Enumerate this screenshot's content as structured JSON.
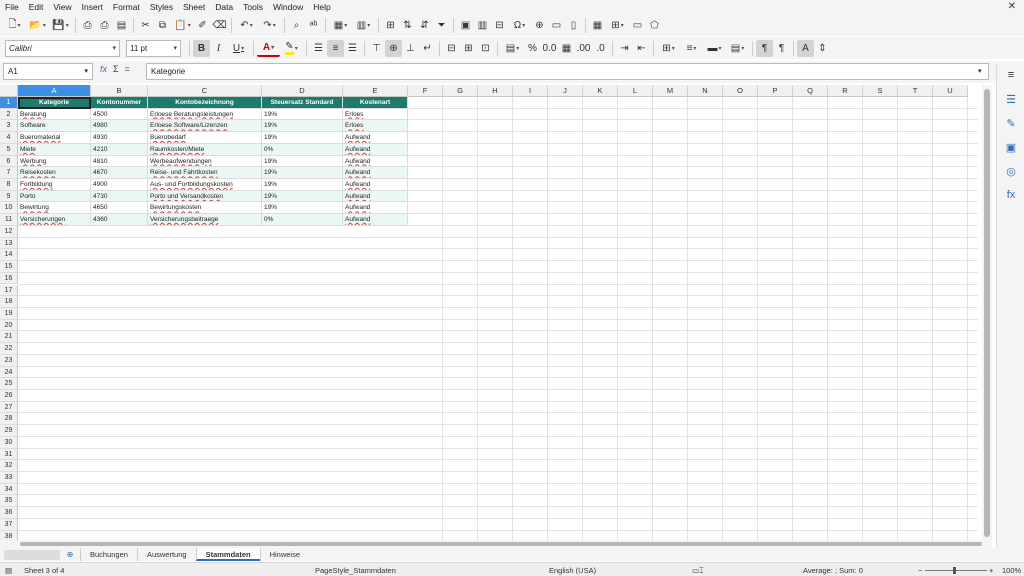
{
  "menu": [
    "File",
    "Edit",
    "View",
    "Insert",
    "Format",
    "Styles",
    "Sheet",
    "Data",
    "Tools",
    "Window",
    "Help"
  ],
  "toolbar": {
    "font_name": "Calibri",
    "font_size": "11 pt",
    "bold": "B",
    "italic": "I",
    "underline": "U",
    "font_color": "A",
    "currency": "$",
    "percent": "%",
    "decimal": "0.0",
    "dec_add": ".00",
    "icons_row1": [
      "new-icon",
      "open-icon",
      "save-icon",
      "export-pdf-icon",
      "print-icon",
      "print-preview-icon",
      "cut-icon",
      "copy-icon",
      "paste-icon",
      "clone-formatting-icon",
      "clear-formatting-icon",
      "undo-icon",
      "redo-icon",
      "find-replace-icon",
      "spelling-icon",
      "row-icon",
      "column-icon",
      "pivot-table-icon",
      "sort-ascending-icon",
      "sort-descending-icon",
      "autofilter-icon",
      "image-icon",
      "chart-icon",
      "pivot-icon",
      "special-character-icon",
      "hyperlink-icon",
      "comment-icon",
      "header-footer-icon",
      "define-print-area-icon",
      "freeze-icon",
      "split-window-icon",
      "show-draw-functions-icon"
    ],
    "icons_row2": [
      "align-left-icon",
      "align-center-icon",
      "align-right-icon",
      "align-top-icon",
      "align-middle-icon",
      "align-bottom-icon",
      "wrap-text-icon",
      "merge-center-icon",
      "merge-icon",
      "unmerge-icon",
      "number-format-icon",
      "percent-icon",
      "currency-icon",
      "date-icon",
      "add-decimal-icon",
      "delete-decimal-icon",
      "increase-indent-icon",
      "decrease-indent-icon",
      "borders-icon",
      "border-style-icon",
      "border-color-icon",
      "conditional-icon",
      "ltr-icon",
      "rtl-icon",
      "wrap-icon",
      "vertical-text-icon"
    ]
  },
  "formula_bar": {
    "name_box": "A1",
    "fx": "fx",
    "sigma": "Σ",
    "equals": "=",
    "content": "Kategorie"
  },
  "columns": [
    "A",
    "B",
    "C",
    "D",
    "E",
    "F",
    "G",
    "H",
    "I",
    "J",
    "K",
    "L",
    "M",
    "N",
    "O",
    "P",
    "Q",
    "R",
    "S",
    "T",
    "U"
  ],
  "row_count": 38,
  "table": {
    "headers": [
      "Kategorie",
      "Kontonummer",
      "Kontobezeichnung",
      "Steuersatz Standard",
      "Kostenart"
    ],
    "rows": [
      [
        "Beratung",
        "4500",
        "Erloese Beratungsleistungen",
        "19%",
        "Erloes"
      ],
      [
        "Software",
        "4980",
        "Erloese Software/Lizenzen",
        "19%",
        "Erloes"
      ],
      [
        "Bueromaterial",
        "4930",
        "Buerobedarf",
        "19%",
        "Aufwand"
      ],
      [
        "Miete",
        "4210",
        "Raumkosten/Miete",
        "0%",
        "Aufwand"
      ],
      [
        "Werbung",
        "4810",
        "Werbeaufwendungen",
        "19%",
        "Aufwand"
      ],
      [
        "Reisekosten",
        "4670",
        "Reise- und Fahrtkosten",
        "19%",
        "Aufwand"
      ],
      [
        "Fortbildung",
        "4900",
        "Aus- und Fortbildungskosten",
        "19%",
        "Aufwand"
      ],
      [
        "Porto",
        "4730",
        "Porto und Versandkosten",
        "19%",
        "Aufwand"
      ],
      [
        "Bewirtung",
        "4650",
        "Bewirtungskosten",
        "19%",
        "Aufwand"
      ],
      [
        "Versicherungen",
        "4360",
        "Versicherungsbeitraege",
        "0%",
        "Aufwand"
      ]
    ]
  },
  "sheet_tabs": [
    "Buchungen",
    "Auswertung",
    "Stammdaten",
    "Hinweise"
  ],
  "active_tab": "Stammdaten",
  "tab_add": "⊕",
  "status": {
    "sheet": "Sheet 3 of 4",
    "page_style": "PageStyle_Stammdaten",
    "language": "English (USA)",
    "summary": "Average: ; Sum: 0",
    "zoom": "100%"
  },
  "sidebar": [
    "properties-icon",
    "styles-icon",
    "gallery-icon",
    "navigator-icon",
    "functions-icon",
    "menu-icon"
  ],
  "colors": {
    "header_fill": "#1e7a6c",
    "alt_fill": "#eaf7f4",
    "selection": "#3d8ee5"
  }
}
